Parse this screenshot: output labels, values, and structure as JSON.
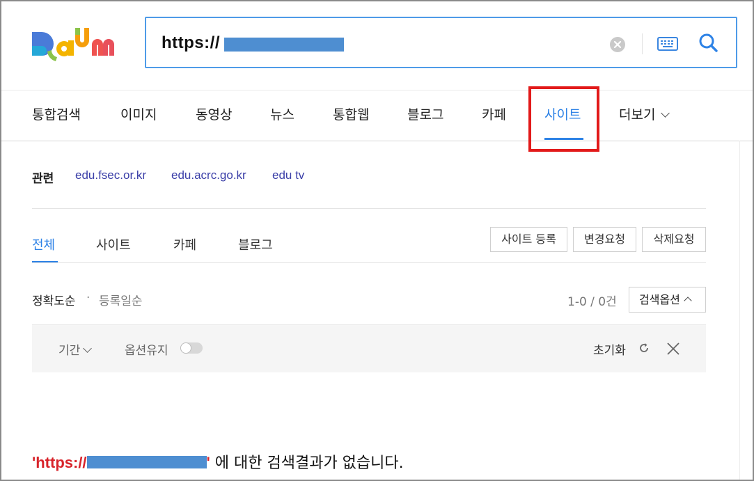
{
  "brand": {
    "logo_text": "Daum"
  },
  "search": {
    "query": "https://",
    "clear_icon": "clear-circle-icon",
    "keyboard_icon": "keyboard-icon",
    "search_icon": "search-icon"
  },
  "nav": {
    "items": [
      {
        "label": "통합검색"
      },
      {
        "label": "이미지"
      },
      {
        "label": "동영상"
      },
      {
        "label": "뉴스"
      },
      {
        "label": "통합웹"
      },
      {
        "label": "블로그"
      },
      {
        "label": "카페"
      },
      {
        "label": "사이트",
        "active": true
      },
      {
        "label": "더보기"
      }
    ],
    "active_index": 7
  },
  "related": {
    "label": "관련",
    "links": [
      "edu.fsec.or.kr",
      "edu.acrc.go.kr",
      "edu tv"
    ]
  },
  "subtabs": {
    "items": [
      {
        "label": "전체",
        "active": true
      },
      {
        "label": "사이트"
      },
      {
        "label": "카페"
      },
      {
        "label": "블로그"
      }
    ],
    "actions": [
      "사이트 등록",
      "변경요청",
      "삭제요청"
    ]
  },
  "sort": {
    "accuracy": "정확도순",
    "separator": "·",
    "registered": "등록일순",
    "count": "1-0 / 0건",
    "options_button": "검색옵션"
  },
  "options": {
    "period": "기간",
    "keep": "옵션유지",
    "keep_on": false,
    "reset": "초기화"
  },
  "result": {
    "query": "'https://",
    "query_close": "'",
    "message": " 에 대한 검색결과가 없습니다."
  },
  "colors": {
    "accent": "#2d82e6",
    "highlight_box": "#e21a1a",
    "redaction": "#4e8ed1",
    "link": "#3b3fa8",
    "result_query": "#d8242b"
  }
}
